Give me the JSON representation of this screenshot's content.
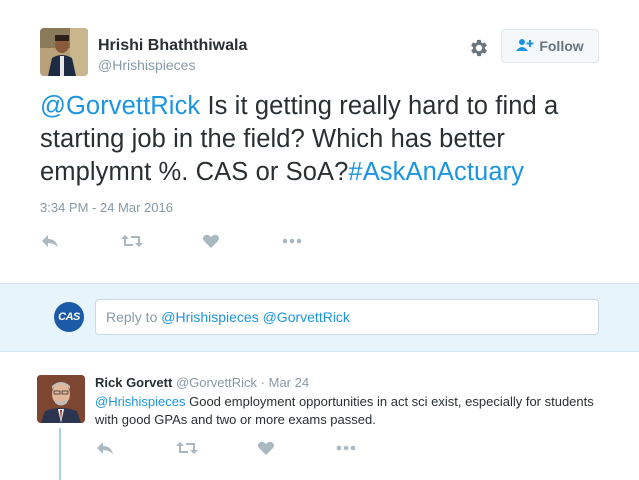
{
  "tweet": {
    "author_name": "Hrishi Bhaththiwala",
    "author_handle": "@Hrishispieces",
    "follow_label": "Follow",
    "text_mention": "@GorvettRick",
    "text_body": " Is it getting really hard to find a starting job in the field? Which has better emplymnt %. CAS or SoA?",
    "text_hashtag": "#AskAnActuary",
    "timestamp": "3:34 PM - 24 Mar 2016",
    "actions": [
      "reply-icon",
      "retweet-icon",
      "like-icon",
      "more-icon"
    ]
  },
  "reply_composer": {
    "placeholder_prefix": "Reply to ",
    "mentions": "@Hrishispieces @GorvettRick",
    "logo_text": "CAS"
  },
  "reply": {
    "author_name": "Rick Gorvett",
    "author_handle": "@GorvettRick",
    "separator": " · ",
    "date": "Mar 24",
    "mention": "@Hrishispieces",
    "text": " Good employment opportunities in act sci exist, especially for students with good GPAs and two or more exams passed.",
    "actions": [
      "reply-icon",
      "retweet-icon",
      "like-icon",
      "more-icon"
    ]
  },
  "colors": {
    "link": "#1b95e0",
    "reply_bg": "#e8f4fb",
    "icon": "#aab8c2",
    "thread": "#a8cfea"
  }
}
